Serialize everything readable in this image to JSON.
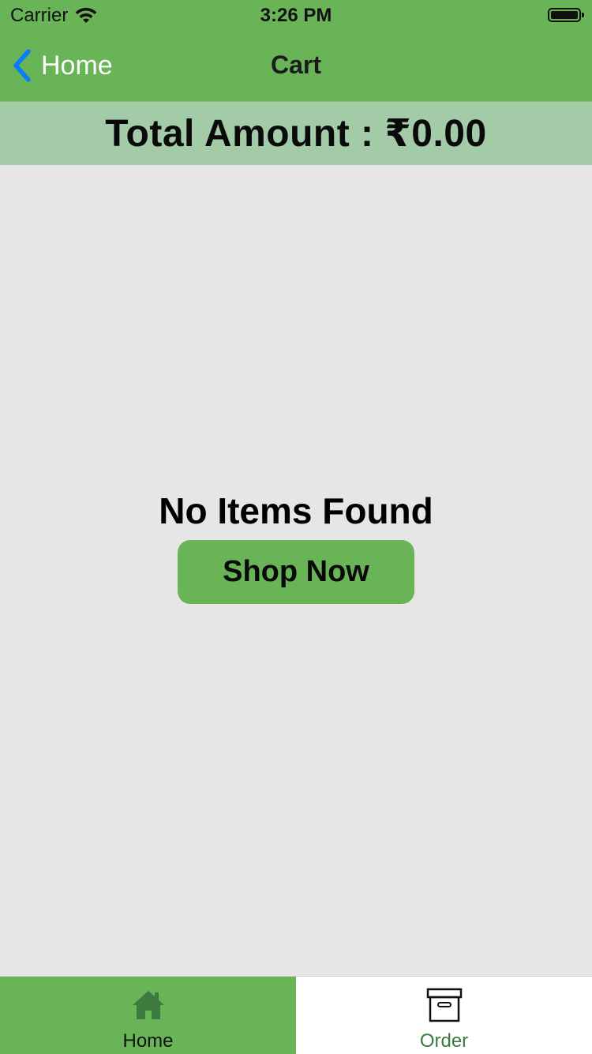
{
  "status_bar": {
    "carrier": "Carrier",
    "time": "3:26 PM",
    "wifi_icon": "wifi-icon",
    "battery_icon": "battery-icon"
  },
  "nav": {
    "back_label": "Home",
    "title": "Cart",
    "back_icon": "chevron-left-icon"
  },
  "total": {
    "label": "Total Amount : ",
    "amount": "₹0.00"
  },
  "empty_state": {
    "message": "No Items Found",
    "button_label": "Shop Now"
  },
  "tab_bar": {
    "tabs": [
      {
        "label": "Home",
        "icon": "home-icon",
        "selected": true
      },
      {
        "label": "Order",
        "icon": "archive-box-icon",
        "selected": false
      }
    ]
  },
  "colors": {
    "brand_green": "#69b457",
    "banner_green": "#a3cba7",
    "background": "#e6e6e6",
    "back_blue": "#0a7aff",
    "order_label_green": "#3b7a3b"
  }
}
